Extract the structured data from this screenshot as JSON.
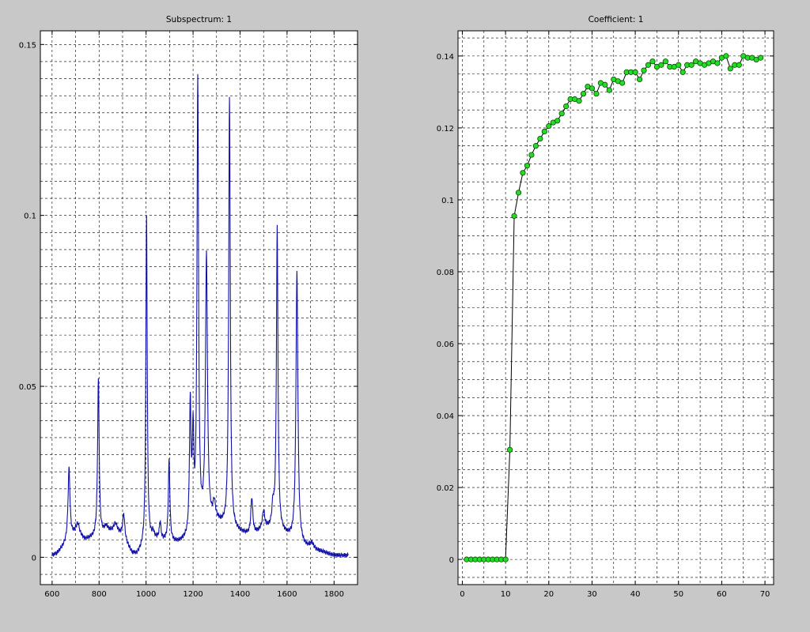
{
  "figure": {
    "background": "#c8c8c8",
    "axes_background": "#ffffff"
  },
  "chart_data": [
    {
      "type": "line",
      "title": "Subspectrum: 1",
      "xlabel": "",
      "ylabel": "",
      "xlim": [
        550,
        1900
      ],
      "ylim": [
        -0.008,
        0.154
      ],
      "xticks": [
        600,
        800,
        1000,
        1200,
        1400,
        1600,
        1800
      ],
      "xtick_labels": [
        "600",
        "800",
        "1000",
        "1200",
        "1400",
        "1600",
        "1800"
      ],
      "yticks": [
        0,
        0.05,
        0.1,
        0.15
      ],
      "ytick_labels": [
        "0",
        "0.05",
        "0.1",
        "0.15"
      ],
      "grid": true,
      "line_color": "#1010a8",
      "series": [
        {
          "baseline": [
            [
              600,
              0.0005
            ],
            [
              620,
              0.001
            ],
            [
              640,
              0.0025
            ],
            [
              700,
              0.007
            ],
            [
              740,
              0.005
            ],
            [
              800,
              0.006
            ],
            [
              850,
              0.007
            ],
            [
              900,
              0.006
            ],
            [
              940,
              0.001
            ],
            [
              960,
              0.0005
            ],
            [
              980,
              0.002
            ],
            [
              1000,
              0.004
            ],
            [
              1050,
              0.005
            ],
            [
              1100,
              0.004
            ],
            [
              1140,
              0.004
            ],
            [
              1200,
              0.005
            ],
            [
              1250,
              0.009
            ],
            [
              1300,
              0.01
            ],
            [
              1350,
              0.008
            ],
            [
              1400,
              0.007
            ],
            [
              1450,
              0.006
            ],
            [
              1500,
              0.008
            ],
            [
              1550,
              0.008
            ],
            [
              1600,
              0.006
            ],
            [
              1640,
              0.004
            ],
            [
              1700,
              0.002
            ],
            [
              1750,
              0.0015
            ],
            [
              1800,
              0.0005
            ],
            [
              1860,
              0.0005
            ]
          ],
          "peaks": [
            {
              "x": 672,
              "h": 0.021,
              "w": 5
            },
            {
              "x": 710,
              "h": 0.003,
              "w": 8
            },
            {
              "x": 797,
              "h": 0.046,
              "w": 4
            },
            {
              "x": 830,
              "h": 0.002,
              "w": 10
            },
            {
              "x": 870,
              "h": 0.003,
              "w": 10
            },
            {
              "x": 905,
              "h": 0.007,
              "w": 5
            },
            {
              "x": 1002,
              "h": 0.096,
              "w": 3.5
            },
            {
              "x": 1030,
              "h": 0.002,
              "w": 6
            },
            {
              "x": 1060,
              "h": 0.005,
              "w": 4
            },
            {
              "x": 1098,
              "h": 0.024,
              "w": 4
            },
            {
              "x": 1188,
              "h": 0.038,
              "w": 4
            },
            {
              "x": 1200,
              "h": 0.028,
              "w": 4
            },
            {
              "x": 1220,
              "h": 0.132,
              "w": 4
            },
            {
              "x": 1257,
              "h": 0.078,
              "w": 5
            },
            {
              "x": 1290,
              "h": 0.005,
              "w": 6
            },
            {
              "x": 1355,
              "h": 0.126,
              "w": 4
            },
            {
              "x": 1450,
              "h": 0.011,
              "w": 5
            },
            {
              "x": 1500,
              "h": 0.005,
              "w": 6
            },
            {
              "x": 1540,
              "h": 0.006,
              "w": 5
            },
            {
              "x": 1558,
              "h": 0.088,
              "w": 4
            },
            {
              "x": 1642,
              "h": 0.079,
              "w": 5
            },
            {
              "x": 1705,
              "h": 0.002,
              "w": 10
            }
          ]
        }
      ]
    },
    {
      "type": "scatter",
      "title": "Coefficient: 1",
      "xlabel": "",
      "ylabel": "",
      "xlim": [
        -1,
        72
      ],
      "ylim": [
        -0.007,
        0.147
      ],
      "xticks": [
        0,
        10,
        20,
        30,
        40,
        50,
        60,
        70
      ],
      "xtick_labels": [
        "0",
        "10",
        "20",
        "30",
        "40",
        "50",
        "60",
        "70"
      ],
      "yticks": [
        0,
        0.02,
        0.04,
        0.06,
        0.08,
        0.1,
        0.12,
        0.14
      ],
      "ytick_labels": [
        "0",
        "0.02",
        "0.04",
        "0.06",
        "0.08",
        "0.1",
        "0.12",
        "0.14"
      ],
      "grid": true,
      "line_color": "#000000",
      "marker_color": "#22dd22",
      "marker_edge": "#0a4a0a",
      "series": [
        {
          "x": [
            1,
            2,
            3,
            4,
            5,
            6,
            7,
            8,
            9,
            10,
            11,
            12,
            13,
            14,
            15,
            16,
            17,
            18,
            19,
            20,
            21,
            22,
            23,
            24,
            25,
            26,
            27,
            28,
            29,
            30,
            31,
            32,
            33,
            34,
            35,
            36,
            37,
            38,
            39,
            40,
            41,
            42,
            43,
            44,
            45,
            46,
            47,
            48,
            49,
            50,
            51,
            52,
            53,
            54,
            55,
            56,
            57,
            58,
            59,
            60,
            61,
            62,
            63,
            64,
            65,
            66,
            67,
            68,
            69
          ],
          "y": [
            0,
            0,
            0,
            0,
            0,
            0,
            0,
            0,
            0,
            0,
            0.0305,
            0.0955,
            0.102,
            0.1075,
            0.1095,
            0.1125,
            0.115,
            0.117,
            0.119,
            0.1205,
            0.1215,
            0.122,
            0.124,
            0.126,
            0.128,
            0.128,
            0.1275,
            0.1295,
            0.1315,
            0.131,
            0.1295,
            0.1325,
            0.132,
            0.1305,
            0.1335,
            0.133,
            0.1325,
            0.1355,
            0.1355,
            0.1355,
            0.1335,
            0.136,
            0.1375,
            0.1385,
            0.137,
            0.1375,
            0.1385,
            0.137,
            0.137,
            0.1375,
            0.1355,
            0.1375,
            0.1375,
            0.1385,
            0.138,
            0.1375,
            0.138,
            0.1385,
            0.138,
            0.1395,
            0.14,
            0.1365,
            0.1375,
            0.1375,
            0.14,
            0.1395,
            0.1395,
            0.139,
            0.1395
          ]
        }
      ]
    }
  ]
}
